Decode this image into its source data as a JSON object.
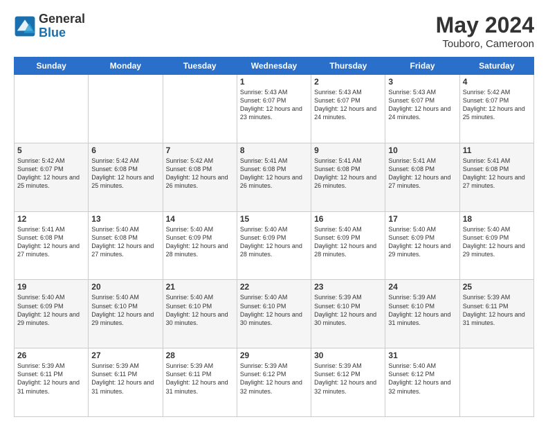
{
  "logo": {
    "general": "General",
    "blue": "Blue"
  },
  "title": "May 2024",
  "location": "Touboro, Cameroon",
  "days_header": [
    "Sunday",
    "Monday",
    "Tuesday",
    "Wednesday",
    "Thursday",
    "Friday",
    "Saturday"
  ],
  "weeks": [
    [
      {
        "day": "",
        "info": ""
      },
      {
        "day": "",
        "info": ""
      },
      {
        "day": "",
        "info": ""
      },
      {
        "day": "1",
        "info": "Sunrise: 5:43 AM\nSunset: 6:07 PM\nDaylight: 12 hours\nand 23 minutes."
      },
      {
        "day": "2",
        "info": "Sunrise: 5:43 AM\nSunset: 6:07 PM\nDaylight: 12 hours\nand 24 minutes."
      },
      {
        "day": "3",
        "info": "Sunrise: 5:43 AM\nSunset: 6:07 PM\nDaylight: 12 hours\nand 24 minutes."
      },
      {
        "day": "4",
        "info": "Sunrise: 5:42 AM\nSunset: 6:07 PM\nDaylight: 12 hours\nand 25 minutes."
      }
    ],
    [
      {
        "day": "5",
        "info": "Sunrise: 5:42 AM\nSunset: 6:07 PM\nDaylight: 12 hours\nand 25 minutes."
      },
      {
        "day": "6",
        "info": "Sunrise: 5:42 AM\nSunset: 6:08 PM\nDaylight: 12 hours\nand 25 minutes."
      },
      {
        "day": "7",
        "info": "Sunrise: 5:42 AM\nSunset: 6:08 PM\nDaylight: 12 hours\nand 26 minutes."
      },
      {
        "day": "8",
        "info": "Sunrise: 5:41 AM\nSunset: 6:08 PM\nDaylight: 12 hours\nand 26 minutes."
      },
      {
        "day": "9",
        "info": "Sunrise: 5:41 AM\nSunset: 6:08 PM\nDaylight: 12 hours\nand 26 minutes."
      },
      {
        "day": "10",
        "info": "Sunrise: 5:41 AM\nSunset: 6:08 PM\nDaylight: 12 hours\nand 27 minutes."
      },
      {
        "day": "11",
        "info": "Sunrise: 5:41 AM\nSunset: 6:08 PM\nDaylight: 12 hours\nand 27 minutes."
      }
    ],
    [
      {
        "day": "12",
        "info": "Sunrise: 5:41 AM\nSunset: 6:08 PM\nDaylight: 12 hours\nand 27 minutes."
      },
      {
        "day": "13",
        "info": "Sunrise: 5:40 AM\nSunset: 6:08 PM\nDaylight: 12 hours\nand 27 minutes."
      },
      {
        "day": "14",
        "info": "Sunrise: 5:40 AM\nSunset: 6:09 PM\nDaylight: 12 hours\nand 28 minutes."
      },
      {
        "day": "15",
        "info": "Sunrise: 5:40 AM\nSunset: 6:09 PM\nDaylight: 12 hours\nand 28 minutes."
      },
      {
        "day": "16",
        "info": "Sunrise: 5:40 AM\nSunset: 6:09 PM\nDaylight: 12 hours\nand 28 minutes."
      },
      {
        "day": "17",
        "info": "Sunrise: 5:40 AM\nSunset: 6:09 PM\nDaylight: 12 hours\nand 29 minutes."
      },
      {
        "day": "18",
        "info": "Sunrise: 5:40 AM\nSunset: 6:09 PM\nDaylight: 12 hours\nand 29 minutes."
      }
    ],
    [
      {
        "day": "19",
        "info": "Sunrise: 5:40 AM\nSunset: 6:09 PM\nDaylight: 12 hours\nand 29 minutes."
      },
      {
        "day": "20",
        "info": "Sunrise: 5:40 AM\nSunset: 6:10 PM\nDaylight: 12 hours\nand 29 minutes."
      },
      {
        "day": "21",
        "info": "Sunrise: 5:40 AM\nSunset: 6:10 PM\nDaylight: 12 hours\nand 30 minutes."
      },
      {
        "day": "22",
        "info": "Sunrise: 5:40 AM\nSunset: 6:10 PM\nDaylight: 12 hours\nand 30 minutes."
      },
      {
        "day": "23",
        "info": "Sunrise: 5:39 AM\nSunset: 6:10 PM\nDaylight: 12 hours\nand 30 minutes."
      },
      {
        "day": "24",
        "info": "Sunrise: 5:39 AM\nSunset: 6:10 PM\nDaylight: 12 hours\nand 31 minutes."
      },
      {
        "day": "25",
        "info": "Sunrise: 5:39 AM\nSunset: 6:11 PM\nDaylight: 12 hours\nand 31 minutes."
      }
    ],
    [
      {
        "day": "26",
        "info": "Sunrise: 5:39 AM\nSunset: 6:11 PM\nDaylight: 12 hours\nand 31 minutes."
      },
      {
        "day": "27",
        "info": "Sunrise: 5:39 AM\nSunset: 6:11 PM\nDaylight: 12 hours\nand 31 minutes."
      },
      {
        "day": "28",
        "info": "Sunrise: 5:39 AM\nSunset: 6:11 PM\nDaylight: 12 hours\nand 31 minutes."
      },
      {
        "day": "29",
        "info": "Sunrise: 5:39 AM\nSunset: 6:12 PM\nDaylight: 12 hours\nand 32 minutes."
      },
      {
        "day": "30",
        "info": "Sunrise: 5:39 AM\nSunset: 6:12 PM\nDaylight: 12 hours\nand 32 minutes."
      },
      {
        "day": "31",
        "info": "Sunrise: 5:40 AM\nSunset: 6:12 PM\nDaylight: 12 hours\nand 32 minutes."
      },
      {
        "day": "",
        "info": ""
      }
    ]
  ]
}
